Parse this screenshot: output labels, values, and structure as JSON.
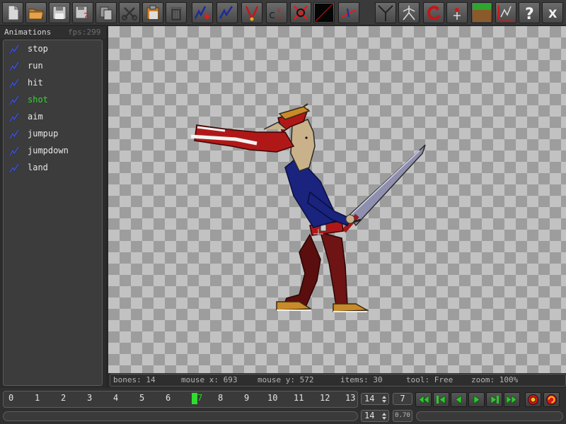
{
  "toolbar": {
    "buttons": [
      "new-file-icon",
      "open-folder-icon",
      "save-icon",
      "save-as-icon",
      "copy-icon",
      "scissors-icon",
      "paste-icon",
      "trash-icon",
      "add-animation-icon",
      "animation-icon",
      "bone-tool-icon",
      "copy-xy-icon",
      "delete-bone-icon",
      "black-swatch-icon",
      "red-line-icon",
      "mirror-icon",
      "skeleton-icon",
      "rotate-icon",
      "pin-icon",
      "grass-tile-icon",
      "graph-icon",
      "help-icon",
      "close-icon"
    ],
    "copy_xy_label": "c",
    "copy_xy_sub": "y\nx",
    "help_label": "?",
    "close_label": "X"
  },
  "panel": {
    "title": "Animations",
    "fps": "fps:299",
    "animations": [
      "stop",
      "run",
      "hit",
      "shot",
      "aim",
      "jumpup",
      "jumpdown",
      "land"
    ],
    "active": "shot"
  },
  "status": {
    "bones": "bones: 14",
    "mouse_x": "mouse x: 693",
    "mouse_y": "mouse y: 572",
    "items": "items: 30",
    "tool": "tool: Free",
    "zoom": "zoom: 100%"
  },
  "timeline": {
    "ticks": [
      "0",
      "1",
      "2",
      "3",
      "4",
      "5",
      "6",
      "7",
      "8",
      "9",
      "10",
      "11",
      "12",
      "13"
    ],
    "current_frame": "7",
    "total_frames": "14",
    "frame_field": "7",
    "length_field": "14",
    "speed": "0.70"
  },
  "playback": {
    "buttons": [
      "rewind-start-icon",
      "prev-key-icon",
      "prev-frame-icon",
      "play-icon",
      "next-frame-icon",
      "next-key-icon",
      "fast-forward-icon",
      "record-icon",
      "loop-icon"
    ]
  },
  "colors": {
    "accent_green": "#35d335",
    "canvas_light": "#c2c2c2",
    "canvas_dark": "#9d9d9d",
    "panel_bg": "#3c3c3c"
  }
}
